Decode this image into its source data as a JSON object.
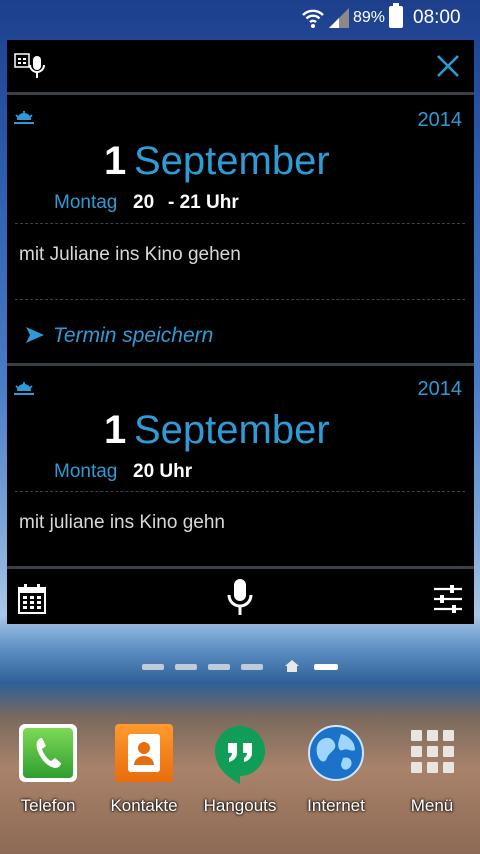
{
  "status_bar": {
    "battery_percent": "89%",
    "time": "08:00"
  },
  "widget": {
    "cards": [
      {
        "year": "2014",
        "day": "1",
        "month": "September",
        "weekday": "Montag",
        "time_start": "20",
        "time_end": "- 21 Uhr",
        "note": "mit Juliane ins Kino gehen",
        "action": "Termin speichern"
      },
      {
        "year": "2014",
        "day": "1",
        "month": "September",
        "weekday": "Montag",
        "time": "20 Uhr",
        "note": "mit juliane ins Kino gehn"
      }
    ]
  },
  "dock": [
    {
      "label": "Telefon",
      "icon": "phone-icon"
    },
    {
      "label": "Kontakte",
      "icon": "contacts-icon"
    },
    {
      "label": "Hangouts",
      "icon": "hangouts-icon"
    },
    {
      "label": "Internet",
      "icon": "globe-icon"
    },
    {
      "label": "Menü",
      "icon": "apps-grid-icon"
    }
  ],
  "colors": {
    "accent": "#2f9bd6",
    "widget_bg": "#000000",
    "divider": "#3b3f46"
  }
}
